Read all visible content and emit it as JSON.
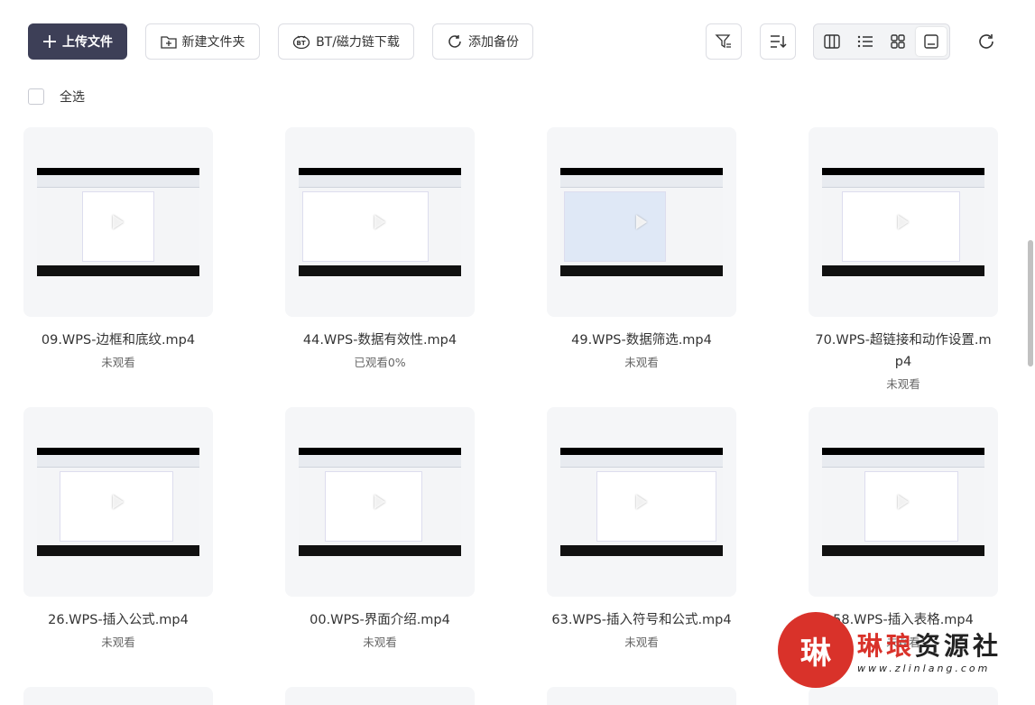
{
  "toolbar": {
    "upload_label": "上传文件",
    "new_folder_label": "新建文件夹",
    "bt_label": "BT/磁力链下载",
    "backup_label": "添加备份"
  },
  "select_all_label": "全选",
  "files": [
    {
      "name": "09.WPS-边框和底纹.mp4",
      "status": "未观看"
    },
    {
      "name": "44.WPS-数据有效性.mp4",
      "status": "已观看0%"
    },
    {
      "name": "49.WPS-数据筛选.mp4",
      "status": "未观看"
    },
    {
      "name": "70.WPS-超链接和动作设置.mp4",
      "status": "未观看"
    },
    {
      "name": "26.WPS-插入公式.mp4",
      "status": "未观看"
    },
    {
      "name": "00.WPS-界面介绍.mp4",
      "status": "未观看"
    },
    {
      "name": "63.WPS-插入符号和公式.mp4",
      "status": "未观看"
    },
    {
      "name": "58.WPS-插入表格.mp4",
      "status": "未观看"
    }
  ],
  "watermark": {
    "logo_char": "琳",
    "title_part1": "琳琅",
    "title_part2": "资源社",
    "url": "www.zlinlang.com"
  },
  "colors": {
    "primary": "#3d3f57",
    "card_bg": "#f5f6f8",
    "watermark_red": "#d9322a"
  }
}
